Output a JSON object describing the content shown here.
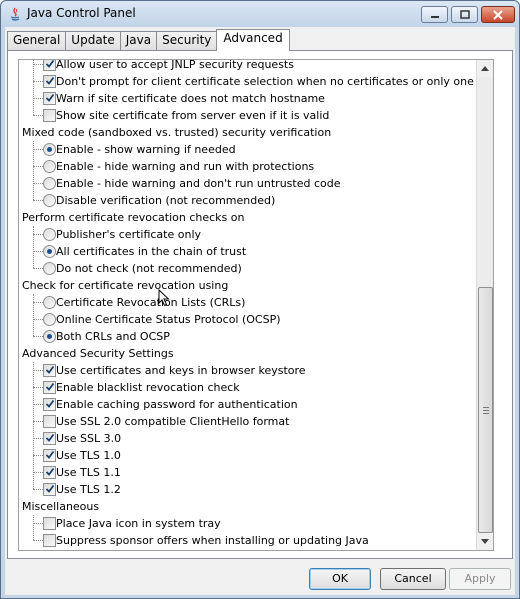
{
  "window": {
    "title": "Java Control Panel"
  },
  "tabs": [
    "General",
    "Update",
    "Java",
    "Security",
    "Advanced"
  ],
  "active_tab": "Advanced",
  "rows": [
    {
      "kind": "opt",
      "control": "checkbox",
      "checked": true,
      "label": "Allow user to accept JNLP security requests"
    },
    {
      "kind": "opt",
      "control": "checkbox",
      "checked": true,
      "label": "Don't prompt for client certificate selection when no certificates or only one exists"
    },
    {
      "kind": "opt",
      "control": "checkbox",
      "checked": true,
      "label": "Warn if site certificate does not match hostname"
    },
    {
      "kind": "opt",
      "control": "checkbox",
      "checked": false,
      "label": "Show site certificate from server even if it is valid"
    },
    {
      "kind": "cat",
      "label": "Mixed code (sandboxed vs. trusted) security verification"
    },
    {
      "kind": "opt",
      "control": "radio",
      "checked": true,
      "label": "Enable - show warning if needed"
    },
    {
      "kind": "opt",
      "control": "radio",
      "checked": false,
      "label": "Enable - hide warning and run with protections"
    },
    {
      "kind": "opt",
      "control": "radio",
      "checked": false,
      "label": "Enable - hide warning and don't run untrusted code"
    },
    {
      "kind": "opt",
      "control": "radio",
      "checked": false,
      "label": "Disable verification (not recommended)"
    },
    {
      "kind": "cat",
      "label": "Perform certificate revocation checks on"
    },
    {
      "kind": "opt",
      "control": "radio",
      "checked": false,
      "label": "Publisher's certificate only"
    },
    {
      "kind": "opt",
      "control": "radio",
      "checked": true,
      "label": "All certificates in the chain of trust"
    },
    {
      "kind": "opt",
      "control": "radio",
      "checked": false,
      "label": "Do not check (not recommended)"
    },
    {
      "kind": "cat",
      "label": "Check for certificate revocation using"
    },
    {
      "kind": "opt",
      "control": "radio",
      "checked": false,
      "label": "Certificate Revocation Lists (CRLs)"
    },
    {
      "kind": "opt",
      "control": "radio",
      "checked": false,
      "label": "Online Certificate Status Protocol (OCSP)"
    },
    {
      "kind": "opt",
      "control": "radio",
      "checked": true,
      "label": "Both CRLs and OCSP"
    },
    {
      "kind": "cat",
      "label": "Advanced Security Settings"
    },
    {
      "kind": "opt",
      "control": "checkbox",
      "checked": true,
      "label": "Use certificates and keys in browser keystore"
    },
    {
      "kind": "opt",
      "control": "checkbox",
      "checked": true,
      "label": "Enable blacklist revocation check"
    },
    {
      "kind": "opt",
      "control": "checkbox",
      "checked": true,
      "label": "Enable caching password for authentication"
    },
    {
      "kind": "opt",
      "control": "checkbox",
      "checked": false,
      "label": "Use SSL 2.0 compatible ClientHello format"
    },
    {
      "kind": "opt",
      "control": "checkbox",
      "checked": true,
      "label": "Use SSL 3.0"
    },
    {
      "kind": "opt",
      "control": "checkbox",
      "checked": true,
      "label": "Use TLS 1.0"
    },
    {
      "kind": "opt",
      "control": "checkbox",
      "checked": true,
      "label": "Use TLS 1.1"
    },
    {
      "kind": "opt",
      "control": "checkbox",
      "checked": true,
      "label": "Use TLS 1.2"
    },
    {
      "kind": "cat",
      "label": "Miscellaneous"
    },
    {
      "kind": "opt",
      "control": "checkbox",
      "checked": false,
      "label": "Place Java icon in system tray"
    },
    {
      "kind": "opt",
      "control": "checkbox",
      "checked": false,
      "label": "Suppress sponsor offers when installing or updating Java"
    }
  ],
  "scrollbar": {
    "position": "bottom"
  },
  "buttons": {
    "ok": "OK",
    "cancel": "Cancel",
    "apply": "Apply",
    "apply_enabled": false
  },
  "icons": [
    "java-logo-icon",
    "minimize-icon",
    "maximize-icon",
    "close-icon",
    "scroll-up-icon",
    "scroll-down-icon",
    "mouse-cursor-icon"
  ]
}
